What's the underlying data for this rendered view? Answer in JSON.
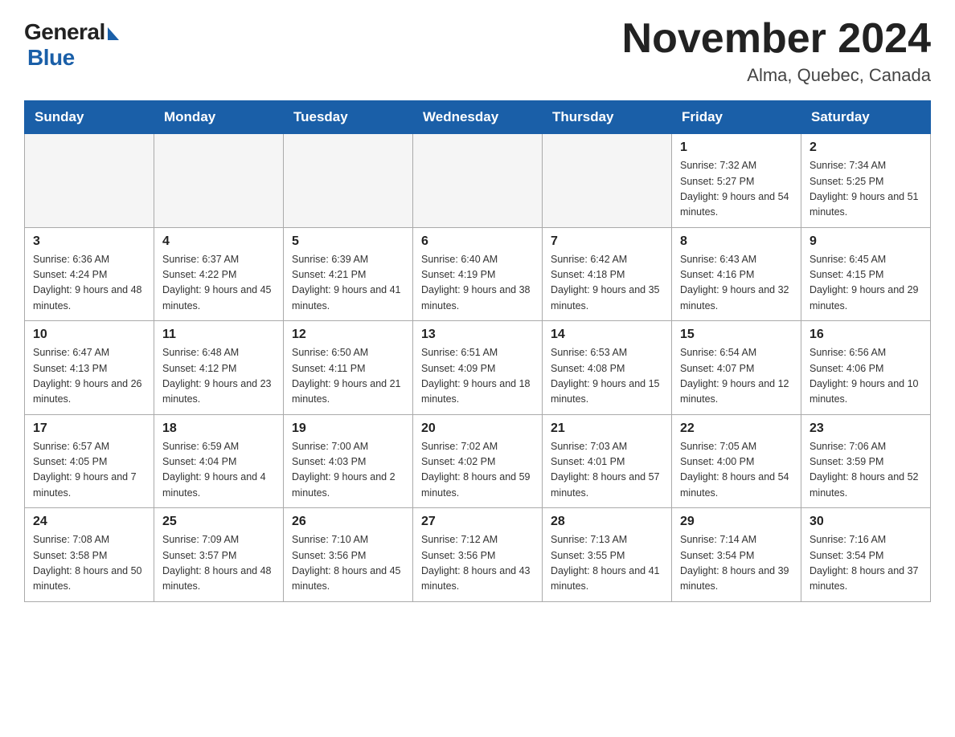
{
  "logo": {
    "general": "General",
    "blue": "Blue"
  },
  "title": "November 2024",
  "location": "Alma, Quebec, Canada",
  "weekdays": [
    "Sunday",
    "Monday",
    "Tuesday",
    "Wednesday",
    "Thursday",
    "Friday",
    "Saturday"
  ],
  "weeks": [
    [
      {
        "num": "",
        "info": ""
      },
      {
        "num": "",
        "info": ""
      },
      {
        "num": "",
        "info": ""
      },
      {
        "num": "",
        "info": ""
      },
      {
        "num": "",
        "info": ""
      },
      {
        "num": "1",
        "info": "Sunrise: 7:32 AM\nSunset: 5:27 PM\nDaylight: 9 hours and 54 minutes."
      },
      {
        "num": "2",
        "info": "Sunrise: 7:34 AM\nSunset: 5:25 PM\nDaylight: 9 hours and 51 minutes."
      }
    ],
    [
      {
        "num": "3",
        "info": "Sunrise: 6:36 AM\nSunset: 4:24 PM\nDaylight: 9 hours and 48 minutes."
      },
      {
        "num": "4",
        "info": "Sunrise: 6:37 AM\nSunset: 4:22 PM\nDaylight: 9 hours and 45 minutes."
      },
      {
        "num": "5",
        "info": "Sunrise: 6:39 AM\nSunset: 4:21 PM\nDaylight: 9 hours and 41 minutes."
      },
      {
        "num": "6",
        "info": "Sunrise: 6:40 AM\nSunset: 4:19 PM\nDaylight: 9 hours and 38 minutes."
      },
      {
        "num": "7",
        "info": "Sunrise: 6:42 AM\nSunset: 4:18 PM\nDaylight: 9 hours and 35 minutes."
      },
      {
        "num": "8",
        "info": "Sunrise: 6:43 AM\nSunset: 4:16 PM\nDaylight: 9 hours and 32 minutes."
      },
      {
        "num": "9",
        "info": "Sunrise: 6:45 AM\nSunset: 4:15 PM\nDaylight: 9 hours and 29 minutes."
      }
    ],
    [
      {
        "num": "10",
        "info": "Sunrise: 6:47 AM\nSunset: 4:13 PM\nDaylight: 9 hours and 26 minutes."
      },
      {
        "num": "11",
        "info": "Sunrise: 6:48 AM\nSunset: 4:12 PM\nDaylight: 9 hours and 23 minutes."
      },
      {
        "num": "12",
        "info": "Sunrise: 6:50 AM\nSunset: 4:11 PM\nDaylight: 9 hours and 21 minutes."
      },
      {
        "num": "13",
        "info": "Sunrise: 6:51 AM\nSunset: 4:09 PM\nDaylight: 9 hours and 18 minutes."
      },
      {
        "num": "14",
        "info": "Sunrise: 6:53 AM\nSunset: 4:08 PM\nDaylight: 9 hours and 15 minutes."
      },
      {
        "num": "15",
        "info": "Sunrise: 6:54 AM\nSunset: 4:07 PM\nDaylight: 9 hours and 12 minutes."
      },
      {
        "num": "16",
        "info": "Sunrise: 6:56 AM\nSunset: 4:06 PM\nDaylight: 9 hours and 10 minutes."
      }
    ],
    [
      {
        "num": "17",
        "info": "Sunrise: 6:57 AM\nSunset: 4:05 PM\nDaylight: 9 hours and 7 minutes."
      },
      {
        "num": "18",
        "info": "Sunrise: 6:59 AM\nSunset: 4:04 PM\nDaylight: 9 hours and 4 minutes."
      },
      {
        "num": "19",
        "info": "Sunrise: 7:00 AM\nSunset: 4:03 PM\nDaylight: 9 hours and 2 minutes."
      },
      {
        "num": "20",
        "info": "Sunrise: 7:02 AM\nSunset: 4:02 PM\nDaylight: 8 hours and 59 minutes."
      },
      {
        "num": "21",
        "info": "Sunrise: 7:03 AM\nSunset: 4:01 PM\nDaylight: 8 hours and 57 minutes."
      },
      {
        "num": "22",
        "info": "Sunrise: 7:05 AM\nSunset: 4:00 PM\nDaylight: 8 hours and 54 minutes."
      },
      {
        "num": "23",
        "info": "Sunrise: 7:06 AM\nSunset: 3:59 PM\nDaylight: 8 hours and 52 minutes."
      }
    ],
    [
      {
        "num": "24",
        "info": "Sunrise: 7:08 AM\nSunset: 3:58 PM\nDaylight: 8 hours and 50 minutes."
      },
      {
        "num": "25",
        "info": "Sunrise: 7:09 AM\nSunset: 3:57 PM\nDaylight: 8 hours and 48 minutes."
      },
      {
        "num": "26",
        "info": "Sunrise: 7:10 AM\nSunset: 3:56 PM\nDaylight: 8 hours and 45 minutes."
      },
      {
        "num": "27",
        "info": "Sunrise: 7:12 AM\nSunset: 3:56 PM\nDaylight: 8 hours and 43 minutes."
      },
      {
        "num": "28",
        "info": "Sunrise: 7:13 AM\nSunset: 3:55 PM\nDaylight: 8 hours and 41 minutes."
      },
      {
        "num": "29",
        "info": "Sunrise: 7:14 AM\nSunset: 3:54 PM\nDaylight: 8 hours and 39 minutes."
      },
      {
        "num": "30",
        "info": "Sunrise: 7:16 AM\nSunset: 3:54 PM\nDaylight: 8 hours and 37 minutes."
      }
    ]
  ]
}
